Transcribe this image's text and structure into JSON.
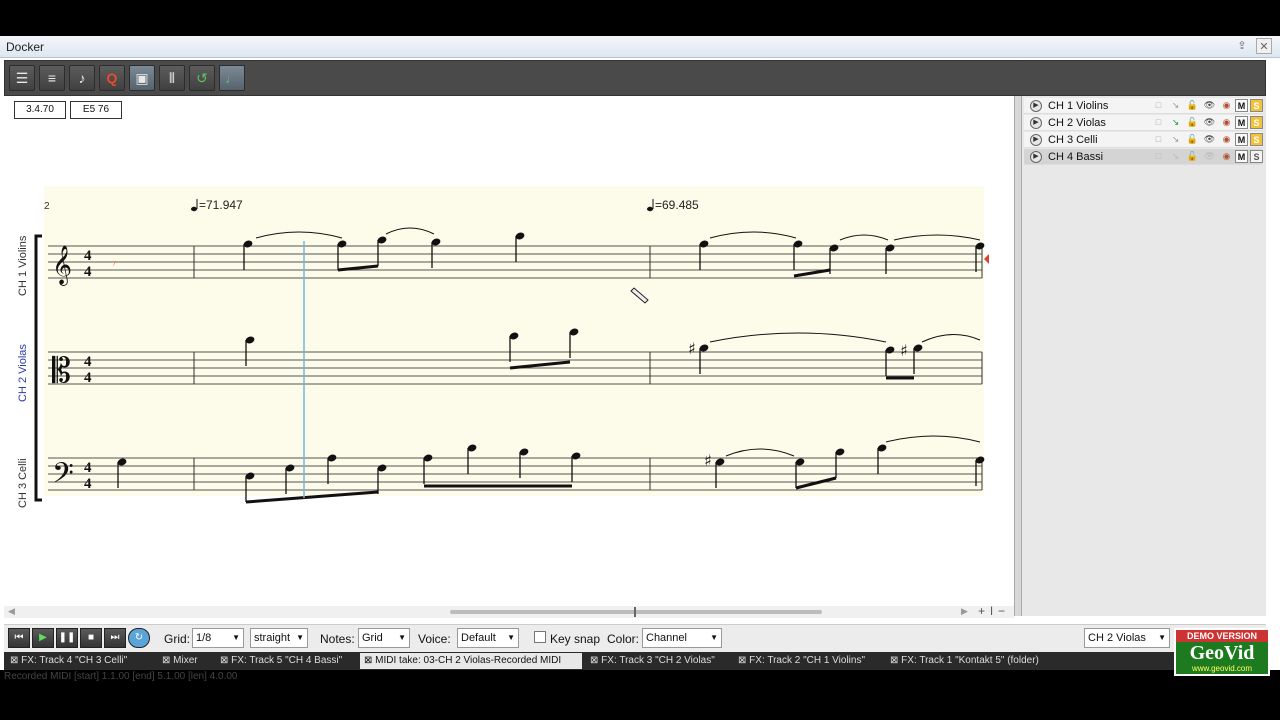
{
  "window": {
    "title": "Docker"
  },
  "toolbar": {
    "icons": [
      "grid-view-icon",
      "list-view-icon",
      "instrument-icon",
      "quantize-icon",
      "screen-icon",
      "piano-roll-icon",
      "undo-loop-icon",
      "note-icon"
    ],
    "quantize_glyph": "Q"
  },
  "position": {
    "time": "3.4.70",
    "pitch": "E5  76"
  },
  "score": {
    "measure_number": "2",
    "tempo_1": "=71.947",
    "tempo_2": "=69.485",
    "staves": [
      {
        "label": "CH 1 Violins",
        "color": "#333333"
      },
      {
        "label": "CH 2 Violas",
        "color": "#2c3eaa"
      },
      {
        "label": "CH 3 Celli",
        "color": "#333333"
      }
    ]
  },
  "tracks": [
    {
      "name": "CH 1 Violins",
      "m": "M",
      "s": "S",
      "selected": false
    },
    {
      "name": "CH 2 Violas",
      "m": "M",
      "s": "S",
      "selected": false
    },
    {
      "name": "CH 3 Celli",
      "m": "M",
      "s": "S",
      "selected": false
    },
    {
      "name": "CH 4 Bassi",
      "m": "M",
      "s": "S",
      "selected": true
    }
  ],
  "bottom": {
    "grid_label": "Grid:",
    "grid_value": "1/8",
    "grid_mode": "straight",
    "notes_label": "Notes:",
    "notes_value": "Grid",
    "voice_label": "Voice:",
    "voice_value": "Default",
    "keysnap_label": "Key snap",
    "color_label": "Color:",
    "color_value": "Channel",
    "track_select": "CH 2 Violas"
  },
  "tabs": [
    "FX: Track 4 \"CH 3 Celli\"",
    "Mixer",
    "FX: Track 5 \"CH 4 Bassi\"",
    "MIDI take: 03-CH 2 Violas-Recorded MIDI",
    "FX: Track 3 \"CH 2 Violas\"",
    "FX: Track 2 \"CH 1 Violins\"",
    "FX: Track 1 \"Kontakt 5\" (folder)"
  ],
  "status": "Recorded MIDI [start] 1.1.00 [end] 5.1.00 [len] 4.0.00",
  "logo": {
    "demo": "DEMO VERSION",
    "brand": "GeoVid",
    "url": "www.geovid.com"
  }
}
